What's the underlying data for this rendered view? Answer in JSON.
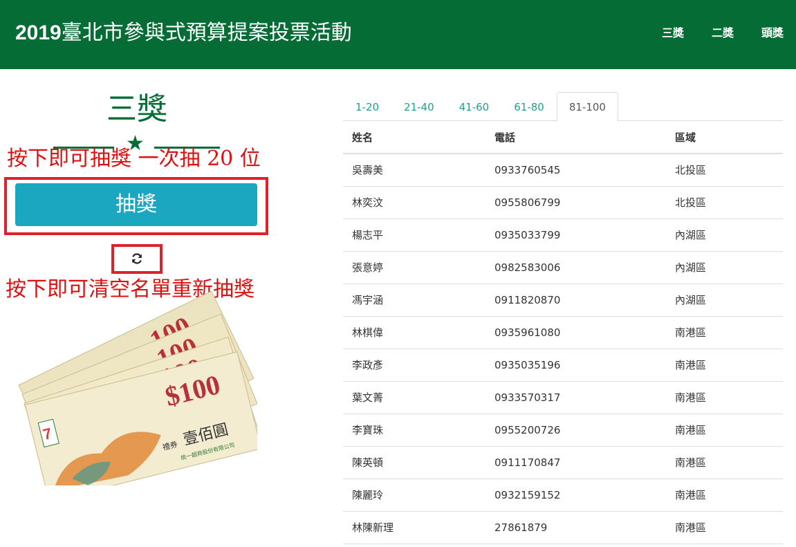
{
  "header": {
    "title_year": "2019",
    "title_rest": "臺北市參與式預算提案投票活動",
    "nav": [
      "三獎",
      "二獎",
      "頭獎"
    ]
  },
  "prize": {
    "title": "三獎",
    "draw_label": "抽獎",
    "reset_icon": "refresh-icon"
  },
  "annotations": {
    "draw_hint": "按下即可抽獎 一次抽 20 位",
    "reset_hint": "按下即可清空名單重新抽獎"
  },
  "voucher": {
    "brand": "7-ELEVEn",
    "amount": "$100",
    "big_amount": "100",
    "chinese_amount": "壹佰圓",
    "label": "禮券",
    "issuer": "統一超商股份有限公司"
  },
  "tabs": [
    "1-20",
    "21-40",
    "41-60",
    "61-80",
    "81-100"
  ],
  "active_tab": "81-100",
  "table": {
    "headers": [
      "姓名",
      "電話",
      "區域"
    ],
    "rows": [
      [
        "吳壽美",
        "0933760545",
        "北投區"
      ],
      [
        "林奕汶",
        "0955806799",
        "北投區"
      ],
      [
        "楊志平",
        "0935033799",
        "內湖區"
      ],
      [
        "張意婷",
        "0982583006",
        "內湖區"
      ],
      [
        "馮宇涵",
        "0911820870",
        "內湖區"
      ],
      [
        "林棋偉",
        "0935961080",
        "南港區"
      ],
      [
        "李政彥",
        "0935035196",
        "南港區"
      ],
      [
        "葉文菁",
        "0933570317",
        "南港區"
      ],
      [
        "李寶珠",
        "0955200726",
        "南港區"
      ],
      [
        "陳英頓",
        "0911170847",
        "南港區"
      ],
      [
        "陳麗玲",
        "0932159152",
        "南港區"
      ],
      [
        "林陳新理",
        "27861879",
        "南港區"
      ]
    ]
  },
  "colors": {
    "header_bg": "#046c34",
    "accent_green": "#046c34",
    "button_bg": "#1ca7c1",
    "tab_link": "#1aa392",
    "annotation_red": "#e01010"
  }
}
